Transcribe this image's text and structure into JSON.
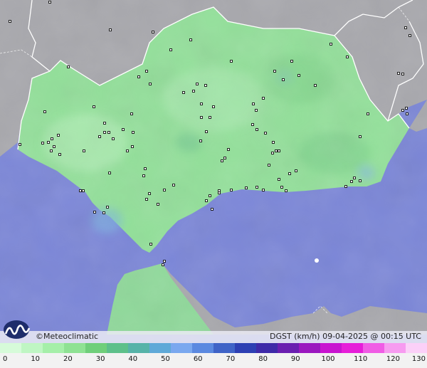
{
  "credit": "©Meteoclimatic",
  "product": "DGST (km/h)   09-04-2025 @ 00:15 UTC",
  "colors": {
    "sea": "#7b86d8",
    "land_outside": "#a8a8ad",
    "land_low_wind": "#93e09a",
    "border": "#ffffff",
    "station": "#111111"
  },
  "legend": {
    "ticks": [
      "0",
      "10",
      "20",
      "30",
      "40",
      "50",
      "60",
      "70",
      "80",
      "90",
      "100",
      "110",
      "120",
      "130"
    ],
    "colors": [
      "#d6fbd9",
      "#bff6c3",
      "#a5efa9",
      "#8ee293",
      "#6fcf7a",
      "#5dc08a",
      "#56b3a8",
      "#5fa9d8",
      "#7aa8ef",
      "#5b89e0",
      "#3f63c7",
      "#2d3fb3",
      "#3e2aa8",
      "#6a1fb0",
      "#9a18bf",
      "#c814d0",
      "#e61ed9",
      "#f05ce5",
      "#f79bf0",
      "#fbd0f8"
    ]
  }
}
